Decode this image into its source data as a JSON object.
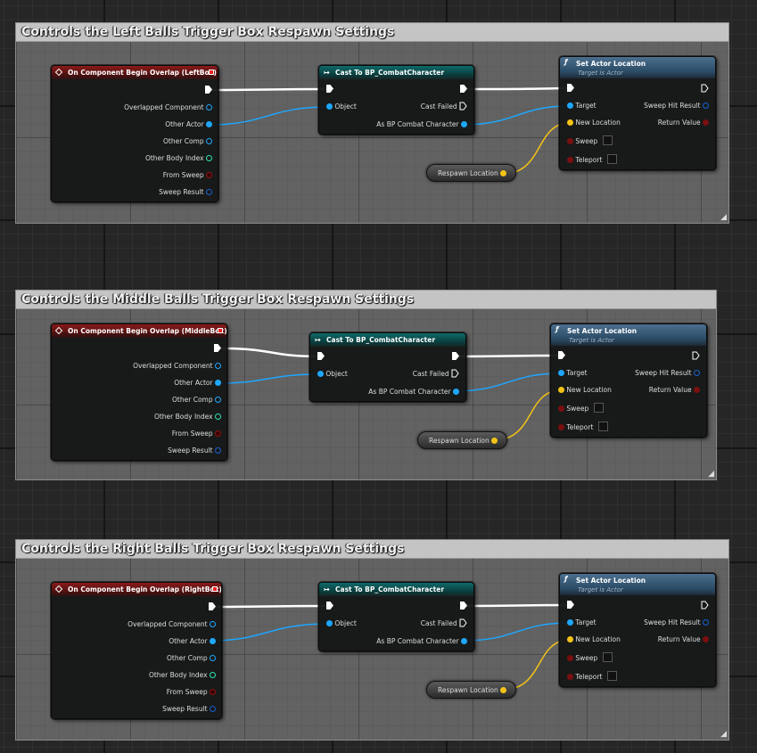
{
  "comments": [
    {
      "title": "Controls the Left Balls Trigger Box Respawn Settings",
      "event_title": "On Component Begin Overlap (LeftBox)",
      "cast_title": "Cast To BP_CombatCharacter",
      "func_title": "Set Actor Location",
      "func_subtitle": "Target is Actor",
      "var_label": "Respawn Location"
    },
    {
      "title": "Controls the Middle Balls Trigger Box Respawn Settings",
      "event_title": "On Component Begin Overlap (MiddleBox)",
      "cast_title": "Cast To BP_CombatCharacter",
      "func_title": "Set Actor Location",
      "func_subtitle": "Target is Actor",
      "var_label": "Respawn Location"
    },
    {
      "title": "Controls the Right Balls Trigger Box Respawn Settings",
      "event_title": "On Component Begin Overlap (RightBox)",
      "cast_title": "Cast To BP_CombatCharacter",
      "func_title": "Set Actor Location",
      "func_subtitle": "Target is Actor",
      "var_label": "Respawn Location"
    }
  ],
  "event_pins": [
    "Overlapped Component",
    "Other Actor",
    "Other Comp",
    "Other Body Index",
    "From Sweep",
    "Sweep Result"
  ],
  "cast_pins": {
    "object": "Object",
    "cast_failed": "Cast Failed",
    "as_output": "As BP Combat Character"
  },
  "func_pins": {
    "target": "Target",
    "new_location": "New Location",
    "sweep": "Sweep",
    "teleport": "Teleport",
    "sweep_hit_result": "Sweep Hit Result",
    "return_value": "Return Value"
  },
  "colors": {
    "event_header": "#8a1a1a",
    "cast_header": "#0f6a6a",
    "function_header": "#4b6f8e",
    "object_pin": "#1ea7ff",
    "vector_pin": "#f4c316",
    "exec_wire": "#ffffff"
  }
}
